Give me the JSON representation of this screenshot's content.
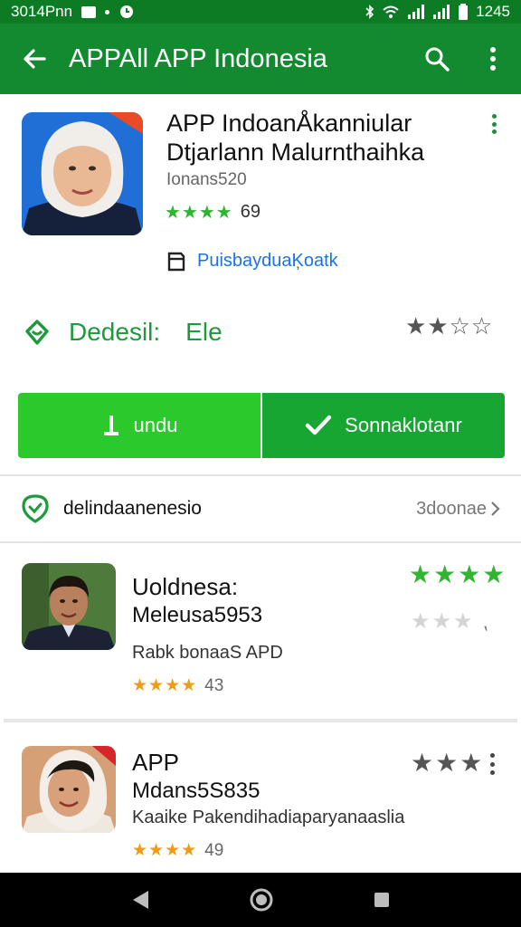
{
  "status_bar": {
    "time_left": "3014Pnn",
    "time_right": "1245"
  },
  "app_bar": {
    "title": "APPAll APP Indonesia"
  },
  "hero": {
    "title_line1": "APP IndoanÅkanniular",
    "title_line2": "Dtjarlann Malurnthaihka",
    "subtitle": "Ionans520",
    "stars": "★★★★",
    "rating_count": "69",
    "developer_link": "PuisbayduaĶoatk"
  },
  "detail": {
    "label": "Dedesil:",
    "value": "Ele",
    "stars": "★★☆☆"
  },
  "buttons": {
    "primary_label": "undu",
    "secondary_label": "Sonnaklotanr"
  },
  "section": {
    "title": "delindaanenesio",
    "more_label": "3doonae"
  },
  "list": [
    {
      "title_line1": "Uoldnesa:",
      "title_line2": "Meleusa5953",
      "desc": "Rabk bonaaS APD",
      "stars": "★★★★",
      "count": "43",
      "stars_top": "★★★★",
      "stars_sub": "★★★",
      "stars_sub_suffix": "⹁"
    },
    {
      "title_line1": "APP",
      "title_line2": "Mdans5S835",
      "desc": "Kaaike Pakendihadiaparyanaaslia",
      "stars": "★★★★",
      "count": "49",
      "stars_top": "★★★"
    }
  ],
  "colors": {
    "status_bar": "#0d7a24",
    "app_bar": "#138a30",
    "accent_green": "#1d9a3a",
    "button_primary": "#2bc92b",
    "button_secondary": "#17a631",
    "star_orange": "#f29a12"
  },
  "icons": {
    "back": "arrow-left-icon",
    "search": "search-icon",
    "more": "more-vert-icon",
    "developer": "bookmark-icon",
    "detail": "tag-icon",
    "download": "download-icon",
    "check": "check-icon",
    "section": "location-pin-icon",
    "chevron": "chevron-right-icon"
  }
}
